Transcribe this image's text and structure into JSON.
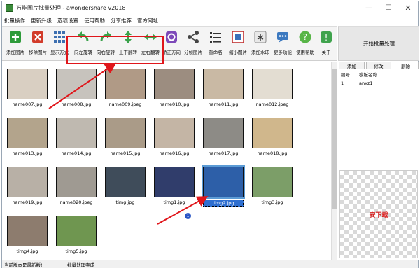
{
  "window": {
    "title": "万能图片批量处理 - awondershare v2018",
    "min_glyph": "—",
    "max_glyph": "☐",
    "close_glyph": "✕"
  },
  "menu": [
    "批量操作",
    "更新升级",
    "选项设置",
    "使用帮助",
    "分享推荐",
    "官方网址"
  ],
  "toolbar": {
    "tools": [
      {
        "label": "添加图片",
        "icon": "add-image-icon"
      },
      {
        "label": "移除图片",
        "icon": "remove-image-icon"
      },
      {
        "label": "显示方式",
        "icon": "view-mode-icon"
      },
      {
        "label": "向左旋转",
        "icon": "rotate-left-icon"
      },
      {
        "label": "向右旋转",
        "icon": "rotate-right-icon"
      },
      {
        "label": "上下翻转",
        "icon": "flip-vertical-icon"
      },
      {
        "label": "左右翻转",
        "icon": "flip-horizontal-icon"
      },
      {
        "label": "矫正方向",
        "icon": "correct-orientation-icon"
      },
      {
        "label": "分帧图片",
        "icon": "split-frames-icon"
      },
      {
        "label": "重命名",
        "icon": "rename-icon"
      },
      {
        "label": "缩小图片",
        "icon": "shrink-image-icon"
      },
      {
        "label": "添加水印",
        "icon": "watermark-icon"
      },
      {
        "label": "更多功能",
        "icon": "more-features-icon"
      },
      {
        "label": "使用帮助",
        "icon": "help-icon"
      },
      {
        "label": "关于",
        "icon": "about-icon"
      }
    ],
    "start_label": "开始批量处理"
  },
  "gallery": {
    "items": [
      {
        "name": "name007.jpg",
        "color": "#d9cfc2"
      },
      {
        "name": "name008.jpg",
        "color": "#c7c3bd"
      },
      {
        "name": "name009.jpeg",
        "color": "#b09a86"
      },
      {
        "name": "name010.jpg",
        "color": "#9c8d80"
      },
      {
        "name": "name011.jpg",
        "color": "#c9b9a4"
      },
      {
        "name": "name012.jpeg",
        "color": "#e3ddd2"
      },
      {
        "name": "name013.jpg",
        "color": "#b3a48c"
      },
      {
        "name": "name014.jpg",
        "color": "#bfb9b0"
      },
      {
        "name": "name015.jpg",
        "color": "#aa9b88"
      },
      {
        "name": "name016.jpg",
        "color": "#c4b5a5"
      },
      {
        "name": "name017.jpg",
        "color": "#8d8b86"
      },
      {
        "name": "name018.jpg",
        "color": "#d0b78c"
      },
      {
        "name": "name019.jpg",
        "color": "#b8b0a6"
      },
      {
        "name": "name020.jpeg",
        "color": "#9f9a92"
      },
      {
        "name": "timg.jpg",
        "color": "#3f4c5a"
      },
      {
        "name": "timg1.jpg",
        "color": "#303d6b"
      },
      {
        "name": "timg2.jpg",
        "color": "#2d5fa8",
        "selected": true
      },
      {
        "name": "timg3.jpg",
        "color": "#7c9e68"
      },
      {
        "name": "timg4.jpg",
        "color": "#8d7c6e"
      },
      {
        "name": "timg5.jpg",
        "color": "#6f9650"
      }
    ],
    "badge": "1"
  },
  "side": {
    "tabs": [
      "添加",
      "修改",
      "删除"
    ],
    "active_tab": 2,
    "headers": [
      "编号",
      "模板名称"
    ],
    "rows": [
      {
        "id": "1",
        "name": "anxz1"
      }
    ],
    "watermark_text": "安下载"
  },
  "status": {
    "left": "当前版本是最新版!",
    "right": "批量处理完成"
  },
  "colors": {
    "highlight": "#e0161b",
    "selection": "#2f6fd0"
  }
}
